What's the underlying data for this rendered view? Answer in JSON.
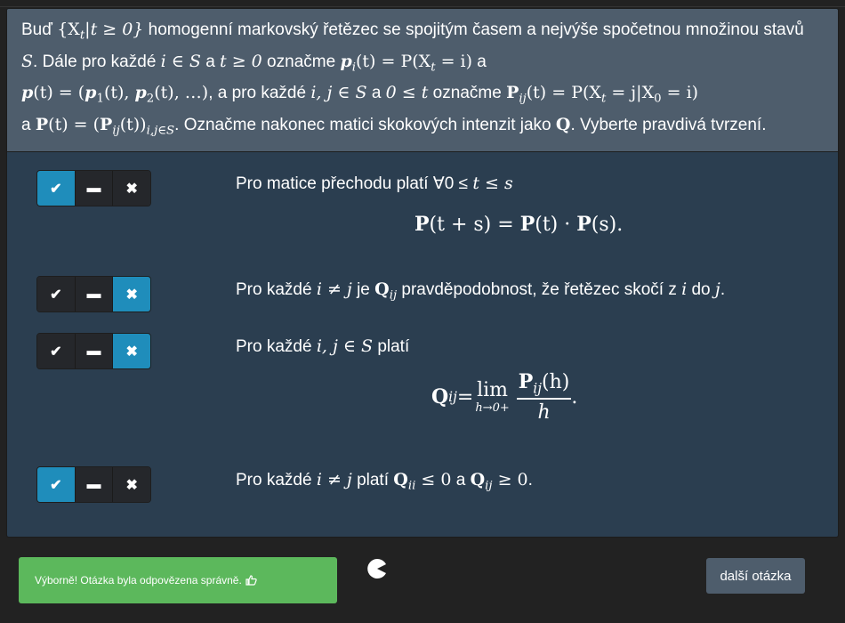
{
  "question": {
    "p1": "Buď",
    "set_expr": "{X",
    "set_sub": "t",
    "set_rest": "|t ≥ 0}",
    "p2": " homogenní markovský řetězec se spojitým časem a nejvýše spočetnou množinou stavů ",
    "S": "S",
    "p3": ". Dále pro každé ",
    "i_in_S": "i ∈ S",
    "p4": " a ",
    "t_ge0": "t ≥ 0",
    "p5": " označme ",
    "pit": "p",
    "pit_sub": "i",
    "pit_rest": "(t) = P(X",
    "pit_rest_sub": "t",
    "pit_rest2": " = i)",
    "p6": " a",
    "pvec": "p",
    "pvec_rest": "(t) = (",
    "p1b": "p",
    "p1b_sub": "1",
    "p1b_rest": "(t), ",
    "p2b": "p",
    "p2b_sub": "2",
    "p2b_rest": "(t), …)",
    "p7": ", a pro každé ",
    "ij_in_S": "i, j ∈ S",
    "p8": " a ",
    "t_range": "0 ≤ t",
    "p9": " označme ",
    "Pij": "P",
    "Pij_sub": "ij",
    "Pij_rest": "(t) = P(X",
    "Pij_rest_sub": "t",
    "Pij_rest2": " = j|X",
    "Pij_rest2_sub": "0",
    "Pij_rest3": " = i)",
    "p10": "a ",
    "Pmat": "P",
    "Pmat_rest": "(t) = (",
    "Pmat2": "P",
    "Pmat2_sub": "ij",
    "Pmat2_rest": "(t))",
    "Pmat2_sub2": "i,j∈S",
    "p11": ". Označme nakonec matici skokových intenzit jako ",
    "Q": "Q",
    "p12": ". Vyberte pravdivá tvrzení."
  },
  "buttons": {
    "check": "✔",
    "dash": "▬",
    "cross": "✖"
  },
  "options": [
    {
      "t1": "Pro matice přechodu platí ∀0 ≤ ",
      "t_var": "t",
      "t2": " ≤ ",
      "s_var": "s",
      "formula_a": "P",
      "formula_b": "(t + s) = ",
      "formula_c": "P",
      "formula_d": "(t) · ",
      "formula_e": "P",
      "formula_f": "(s)."
    },
    {
      "t1": "Pro každé ",
      "m1": "i ≠ j",
      "t2": " je ",
      "Q": "Q",
      "Qsub": "ij",
      "t3": " pravděpodobnost, že řetězec skočí z ",
      "m2": "i",
      "t4": " do ",
      "m3": "j",
      "t5": "."
    },
    {
      "t1": "Pro každé ",
      "m1": "i, j ∈ S",
      "t2": " platí",
      "Q": "Q",
      "Qsub": "ij",
      "eq": " = ",
      "lim": "lim",
      "lim_under": "h→0+",
      "num_P": "P",
      "num_sub": "ij",
      "num_rest": "(h)",
      "den": "h",
      "end": "."
    },
    {
      "t1": "Pro každé ",
      "m1": "i ≠ j",
      "t2": " platí ",
      "Q1": "Q",
      "Q1sub": "ii",
      "rel1": " ≤ 0",
      "t3": " a ",
      "Q2": "Q",
      "Q2sub": "ij",
      "rel2": " ≥ 0",
      "t4": "."
    }
  ],
  "feedback": {
    "text": "Výborně! Otázka byla odpovězena správně.",
    "icon": "thumbs-up-icon"
  },
  "next_button": "další otázka",
  "colors": {
    "header_bg": "#4e5d6c",
    "panel_bg": "#2b3e50",
    "active_btn": "#1f8dbb",
    "success": "#5cb85c"
  }
}
